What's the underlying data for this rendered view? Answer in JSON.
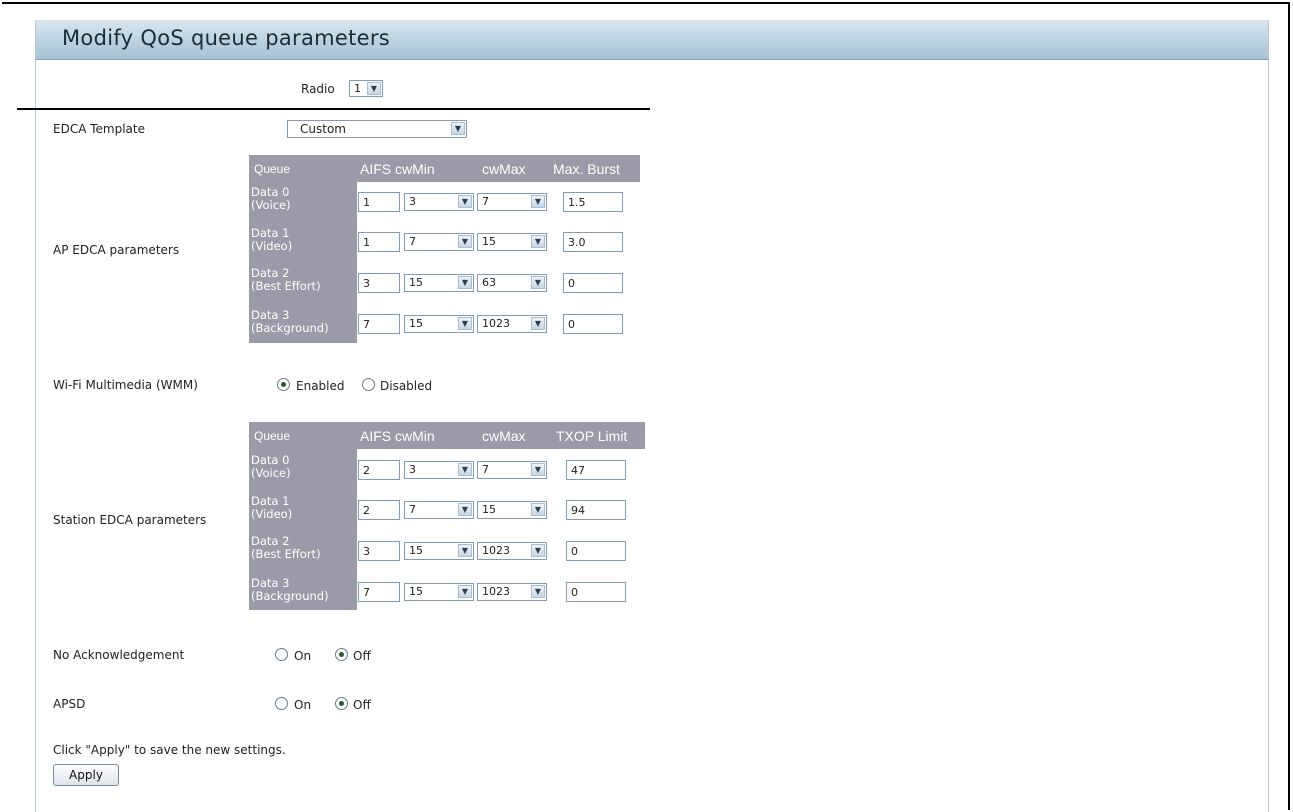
{
  "page": {
    "title": "Modify QoS queue parameters",
    "radio_label": "Radio",
    "radio_value": "1",
    "edca_template_label": "EDCA Template",
    "edca_template_value": "Custom",
    "ap_edca": {
      "label": "AP EDCA parameters",
      "headers": [
        "Queue",
        "AIFS",
        "cwMin",
        "cwMax",
        "Max. Burst"
      ],
      "rows": [
        {
          "queue_line1": "Data 0",
          "queue_line2": "(Voice)",
          "aifs": "1",
          "cwmin": "3",
          "cwmax": "7",
          "last": "1.5"
        },
        {
          "queue_line1": "Data 1",
          "queue_line2": "(Video)",
          "aifs": "1",
          "cwmin": "7",
          "cwmax": "15",
          "last": "3.0"
        },
        {
          "queue_line1": "Data 2",
          "queue_line2": "(Best Effort)",
          "aifs": "3",
          "cwmin": "15",
          "cwmax": "63",
          "last": "0"
        },
        {
          "queue_line1": "Data 3",
          "queue_line2": "(Background)",
          "aifs": "7",
          "cwmin": "15",
          "cwmax": "1023",
          "last": "0"
        }
      ]
    },
    "wmm": {
      "label": "Wi-Fi Multimedia (WMM)",
      "option_enabled": "Enabled",
      "option_disabled": "Disabled",
      "selected": "Enabled"
    },
    "station_edca": {
      "label": "Station EDCA parameters",
      "headers": [
        "Queue",
        "AIFS",
        "cwMin",
        "cwMax",
        "TXOP Limit"
      ],
      "rows": [
        {
          "queue_line1": "Data 0",
          "queue_line2": "(Voice)",
          "aifs": "2",
          "cwmin": "3",
          "cwmax": "7",
          "last": "47"
        },
        {
          "queue_line1": "Data 1",
          "queue_line2": "(Video)",
          "aifs": "2",
          "cwmin": "7",
          "cwmax": "15",
          "last": "94"
        },
        {
          "queue_line1": "Data 2",
          "queue_line2": "(Best Effort)",
          "aifs": "3",
          "cwmin": "15",
          "cwmax": "1023",
          "last": "0"
        },
        {
          "queue_line1": "Data 3",
          "queue_line2": "(Background)",
          "aifs": "7",
          "cwmin": "15",
          "cwmax": "1023",
          "last": "0"
        }
      ]
    },
    "no_ack": {
      "label": "No Acknowledgement",
      "option_on": "On",
      "option_off": "Off",
      "selected": "Off"
    },
    "apsd": {
      "label": "APSD",
      "option_on": "On",
      "option_off": "Off",
      "selected": "Off"
    },
    "hint": "Click \"Apply\" to save the new settings.",
    "apply_label": "Apply"
  },
  "icons": {
    "dropdown_arrow": "chevron-down-icon"
  }
}
